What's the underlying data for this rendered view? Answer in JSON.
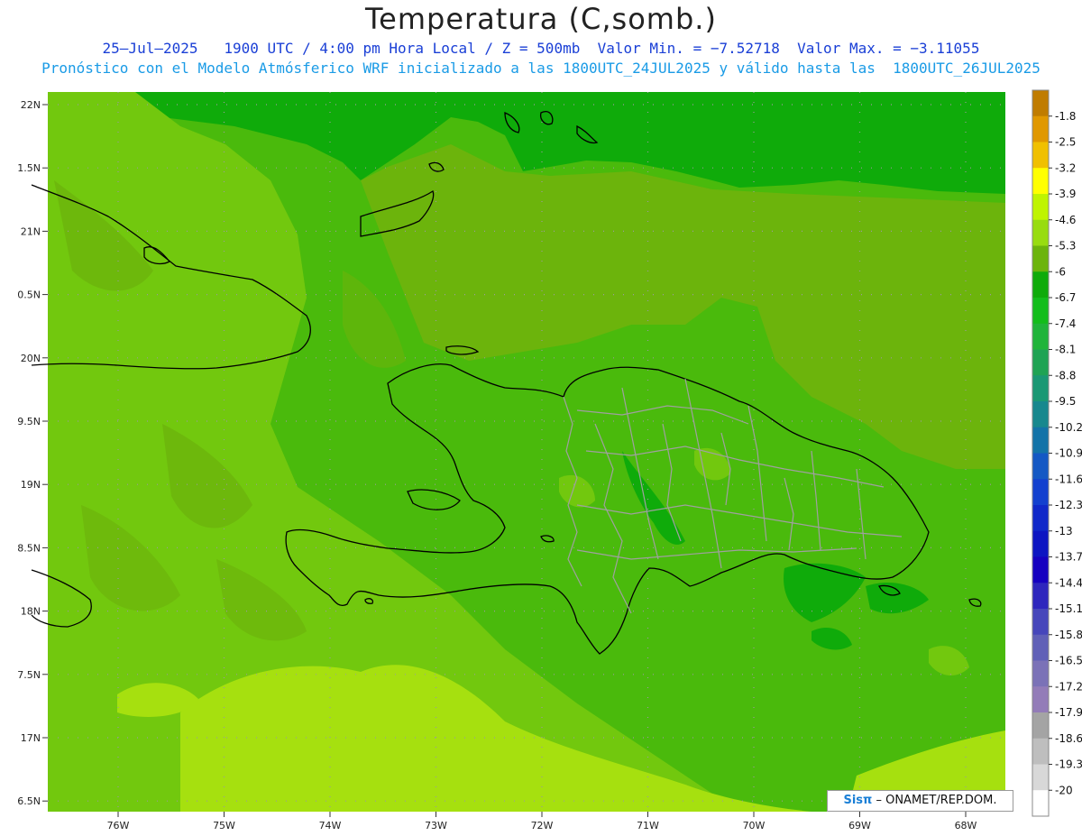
{
  "title": "Temperatura (C,somb.)",
  "subtitle_line1": "25–Jul–2025   1900 UTC / 4:00 pm Hora Local / Z = 500mb  Valor Min. = −7.52718  Valor Max. = −3.11055",
  "subtitle_line2": "Pronóstico con el Modelo Atmósferico WRF inicializado a las 1800UTC_24JUL2025 y válido hasta las  1800UTC_26JUL2025",
  "credit": {
    "brand": "Sisπ",
    "text": "– ONAMET/REP.DOM."
  },
  "colors": {
    "dark_green": "#0fab0a",
    "mid_green": "#4aba0c",
    "light_green": "#72c80e",
    "lime": "#a6e00f",
    "boundary": "#000000",
    "province": "#a0a0a0"
  },
  "latitude_labels": [
    "22N",
    "1.5N",
    "21N",
    "0.5N",
    "20N",
    "9.5N",
    "19N",
    "8.5N",
    "18N",
    "7.5N",
    "17N",
    "6.5N"
  ],
  "longitude_labels": [
    "76W",
    "75W",
    "74W",
    "73W",
    "72W",
    "71W",
    "70W",
    "69W",
    "68W"
  ],
  "colorbar": {
    "labels": [
      "-1.8",
      "-2.5",
      "-3.2",
      "-3.9",
      "-4.6",
      "-5.3",
      "-6",
      "-6.7",
      "-7.4",
      "-8.1",
      "-8.8",
      "-9.5",
      "-10.2",
      "-10.9",
      "-11.6",
      "-12.3",
      "-13",
      "-13.7",
      "-14.4",
      "-15.1",
      "-15.8",
      "-16.5",
      "-17.2",
      "-17.9",
      "-18.6",
      "-19.3",
      "-20"
    ],
    "colors": [
      "#c07c00",
      "#e09800",
      "#f0c000",
      "#ffff00",
      "#bff400",
      "#98dc10",
      "#6cb40c",
      "#0fab0a",
      "#13bd1b",
      "#20b43a",
      "#1fa354",
      "#1a9874",
      "#17888e",
      "#1373a8",
      "#1458c4",
      "#1340cf",
      "#1028c9",
      "#0d15c2",
      "#1600c0",
      "#2e26bd",
      "#4646bb",
      "#6060b7",
      "#7b72b7",
      "#937cb8",
      "#a4a4a4",
      "#bebebe",
      "#d8d8d8",
      "#ffffff"
    ]
  }
}
